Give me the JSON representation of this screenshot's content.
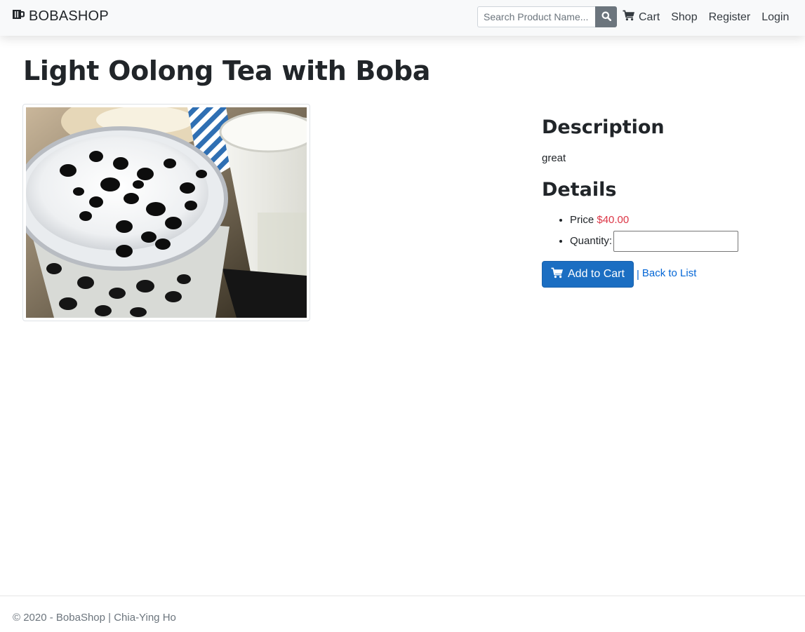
{
  "navbar": {
    "brand": "BOBASHOP",
    "search": {
      "placeholder": "Search Product Name...",
      "value": ""
    },
    "links": {
      "cart": "Cart",
      "shop": "Shop",
      "register": "Register",
      "login": "Login"
    }
  },
  "product": {
    "title": "Light Oolong Tea with Boba",
    "description_heading": "Description",
    "description": "great",
    "details_heading": "Details",
    "price_label": "Price",
    "price": "$40.00",
    "quantity_label": "Quantity:",
    "quantity_value": ""
  },
  "actions": {
    "add_to_cart": "Add to Cart",
    "separator": "|",
    "back_to_list": "Back to List"
  },
  "footer": {
    "text": "© 2020 - BobaShop | Chia-Ying Ho"
  },
  "colors": {
    "primary": "#1b6ec2",
    "price": "#dc3545",
    "link": "#0366d6",
    "navbar_bg": "#f8f9fa"
  },
  "icons": [
    "boba-cup-icon",
    "search-icon",
    "cart-icon"
  ]
}
